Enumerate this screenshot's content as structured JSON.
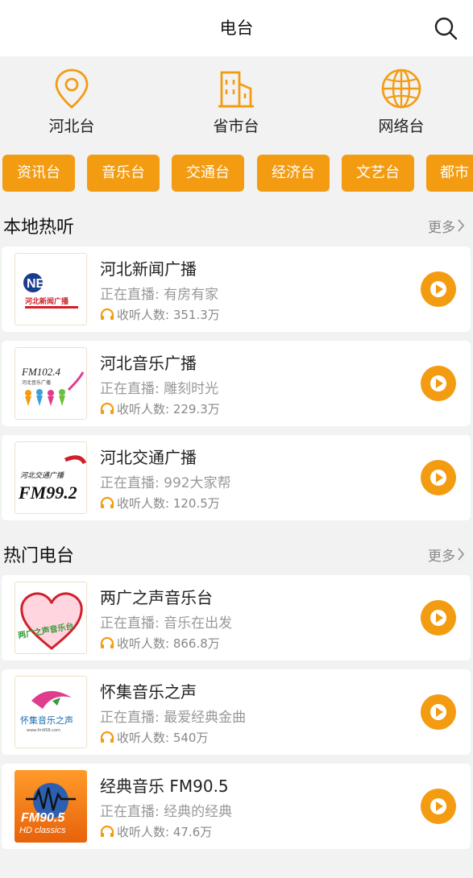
{
  "header": {
    "title": "电台",
    "search_icon": "search-icon"
  },
  "categories": [
    {
      "label": "河北台",
      "icon": "location-pin-icon"
    },
    {
      "label": "省市台",
      "icon": "building-icon"
    },
    {
      "label": "网络台",
      "icon": "globe-icon"
    }
  ],
  "chips": [
    "资讯台",
    "音乐台",
    "交通台",
    "经济台",
    "文艺台",
    "都市"
  ],
  "sections": [
    {
      "title": "本地热听",
      "more": "更多",
      "items": [
        {
          "name": "河北新闻广播",
          "live_label": "正在直播:",
          "live": "有房有家",
          "listen_label": "收听人数:",
          "listeners": "351.3万",
          "logo_text": "NEWS",
          "logo_sub": "河北新闻广播"
        },
        {
          "name": "河北音乐广播",
          "live_label": "正在直播:",
          "live": "雕刻时光",
          "listen_label": "收听人数:",
          "listeners": "229.3万",
          "logo_text": "FM102.4",
          "logo_sub": "河北音乐广播"
        },
        {
          "name": "河北交通广播",
          "live_label": "正在直播:",
          "live": "992大家帮",
          "listen_label": "收听人数:",
          "listeners": "120.5万",
          "logo_text": "FM99.2",
          "logo_sub": "河北交通广播"
        }
      ]
    },
    {
      "title": "热门电台",
      "more": "更多",
      "items": [
        {
          "name": "两广之声音乐台",
          "live_label": "正在直播:",
          "live": "音乐在出发",
          "listen_label": "收听人数:",
          "listeners": "866.8万",
          "logo_text": "两广之声音乐台",
          "logo_sub": ""
        },
        {
          "name": "怀集音乐之声",
          "live_label": "正在直播:",
          "live": "最爱经典金曲",
          "listen_label": "收听人数:",
          "listeners": "540万",
          "logo_text": "怀集音乐之声",
          "logo_sub": "www.fm958.com"
        },
        {
          "name": "经典音乐 FM90.5",
          "live_label": "正在直播:",
          "live": "经典的经典",
          "listen_label": "收听人数:",
          "listeners": "47.6万",
          "logo_text": "FM90.5",
          "logo_sub": "HD classics"
        }
      ]
    }
  ],
  "colors": {
    "accent": "#f39c12",
    "background": "#f2f2f2"
  }
}
